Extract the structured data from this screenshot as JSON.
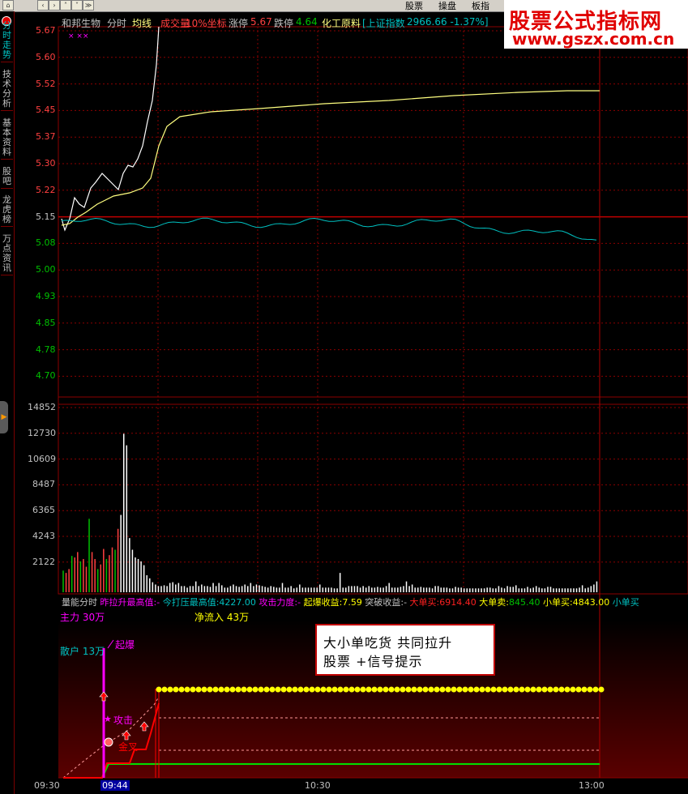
{
  "topbar": {
    "nav_icons": [
      "home-icon",
      "back-icon",
      "forward-icon",
      "up-icon",
      "down-icon",
      "expand-icon"
    ],
    "menu": [
      "股票",
      "操盘",
      "板指"
    ]
  },
  "sidebar": {
    "tabs": [
      "分时走势",
      "技术分析",
      "基本资料",
      "股吧",
      "龙虎榜",
      "万点资讯"
    ]
  },
  "logo": {
    "line1": "股票公式指标网",
    "line2": "www.gszx.com.cn"
  },
  "header": {
    "stock_name": "和邦生物",
    "chart_type": "分时",
    "avg_line": "均线",
    "volume_cn": "成交量",
    "scale": "10%坐标",
    "limit_up_label": "涨停",
    "limit_up_value": "5.67",
    "limit_down_label": "跌停",
    "limit_down_value": "4.64",
    "sector": "化工原料",
    "index_label": "[上证指数",
    "index_value": "2966.66 -1.37%]"
  },
  "price_axis": [
    "5.67",
    "5.60",
    "5.52",
    "5.45",
    "5.37",
    "5.30",
    "5.22",
    "5.15",
    "5.08",
    "5.00",
    "4.93",
    "4.85",
    "4.78",
    "4.70"
  ],
  "volume_axis": [
    "14852",
    "12730",
    "10609",
    "8487",
    "6365",
    "4243",
    "2122"
  ],
  "indicator_header": {
    "name": "量能分时",
    "f1_label": "昨拉升最高值:",
    "f1_value": "-",
    "f2_label": "今打压最高值:",
    "f2_value": "4227.00",
    "f3_label": "攻击力度:",
    "f3_value": "-",
    "f4_label": "起爆收益:",
    "f4_value": "7.59",
    "f5_label": "突破收益:",
    "f5_value": "-",
    "f6_label": "大单买:",
    "f6_value": "6914.40",
    "f7_label": "大单卖:",
    "f7_value": "845.40",
    "f8_label": "小单买:",
    "f8_value": "4843.00",
    "f9_label": "小单买"
  },
  "indicator_labels": {
    "main_force": "主力 30万",
    "retail": "散户 13万",
    "net_inflow": "净流入 43万",
    "signal_qibao": "起爆",
    "signal_gongji": "攻击",
    "signal_jincha": "金叉"
  },
  "note": {
    "line1": "大小单吃货 共同拉升",
    "line2": "股票 +信号提示"
  },
  "time_axis": [
    "09:30",
    "09:44",
    "10:30",
    "13:00"
  ],
  "colors": {
    "price_line": "#ffffff",
    "avg_line": "#ffff80",
    "index_line": "#00c0c0",
    "up": "#ff4040",
    "down": "#00c000",
    "grid": "#8b0000",
    "yellow_chain": "#ffff00",
    "magenta": "#ff00ff"
  }
}
